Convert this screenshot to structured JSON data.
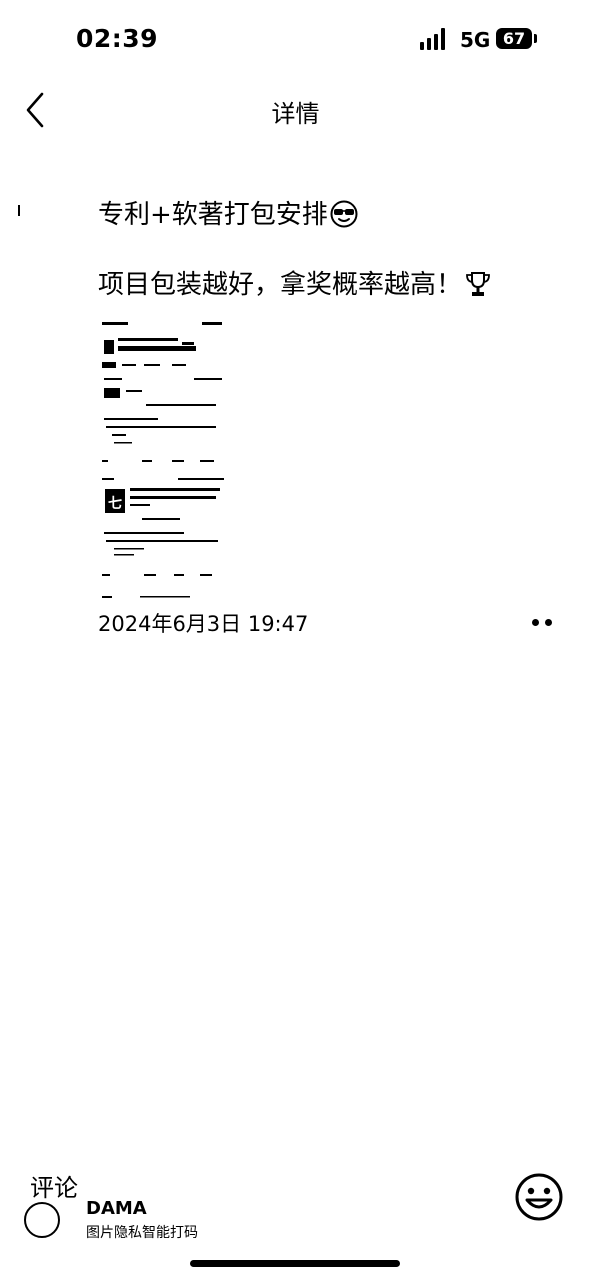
{
  "status_bar": {
    "time": "02:39",
    "network": "5G",
    "battery": "67",
    "signal_icon": "signal-bars-icon"
  },
  "nav": {
    "title": "详情",
    "back_icon": "chevron-left-icon"
  },
  "post": {
    "line1": "专利+软著打包安排",
    "line1_emoji": "sunglasses-face-icon",
    "line2": "项目包装越好，拿奖概率越高！",
    "line2_emoji": "trophy-icon",
    "thumbnail": "document-thumbnail",
    "timestamp": "2024年6月3日 19:47",
    "more_icon": "more-dots-icon"
  },
  "bottom_bar": {
    "comment_label": "评论",
    "watermark_title": "DAMA",
    "watermark_subtitle": "图片隐私智能打码",
    "emoji_icon": "smiley-face-icon"
  }
}
